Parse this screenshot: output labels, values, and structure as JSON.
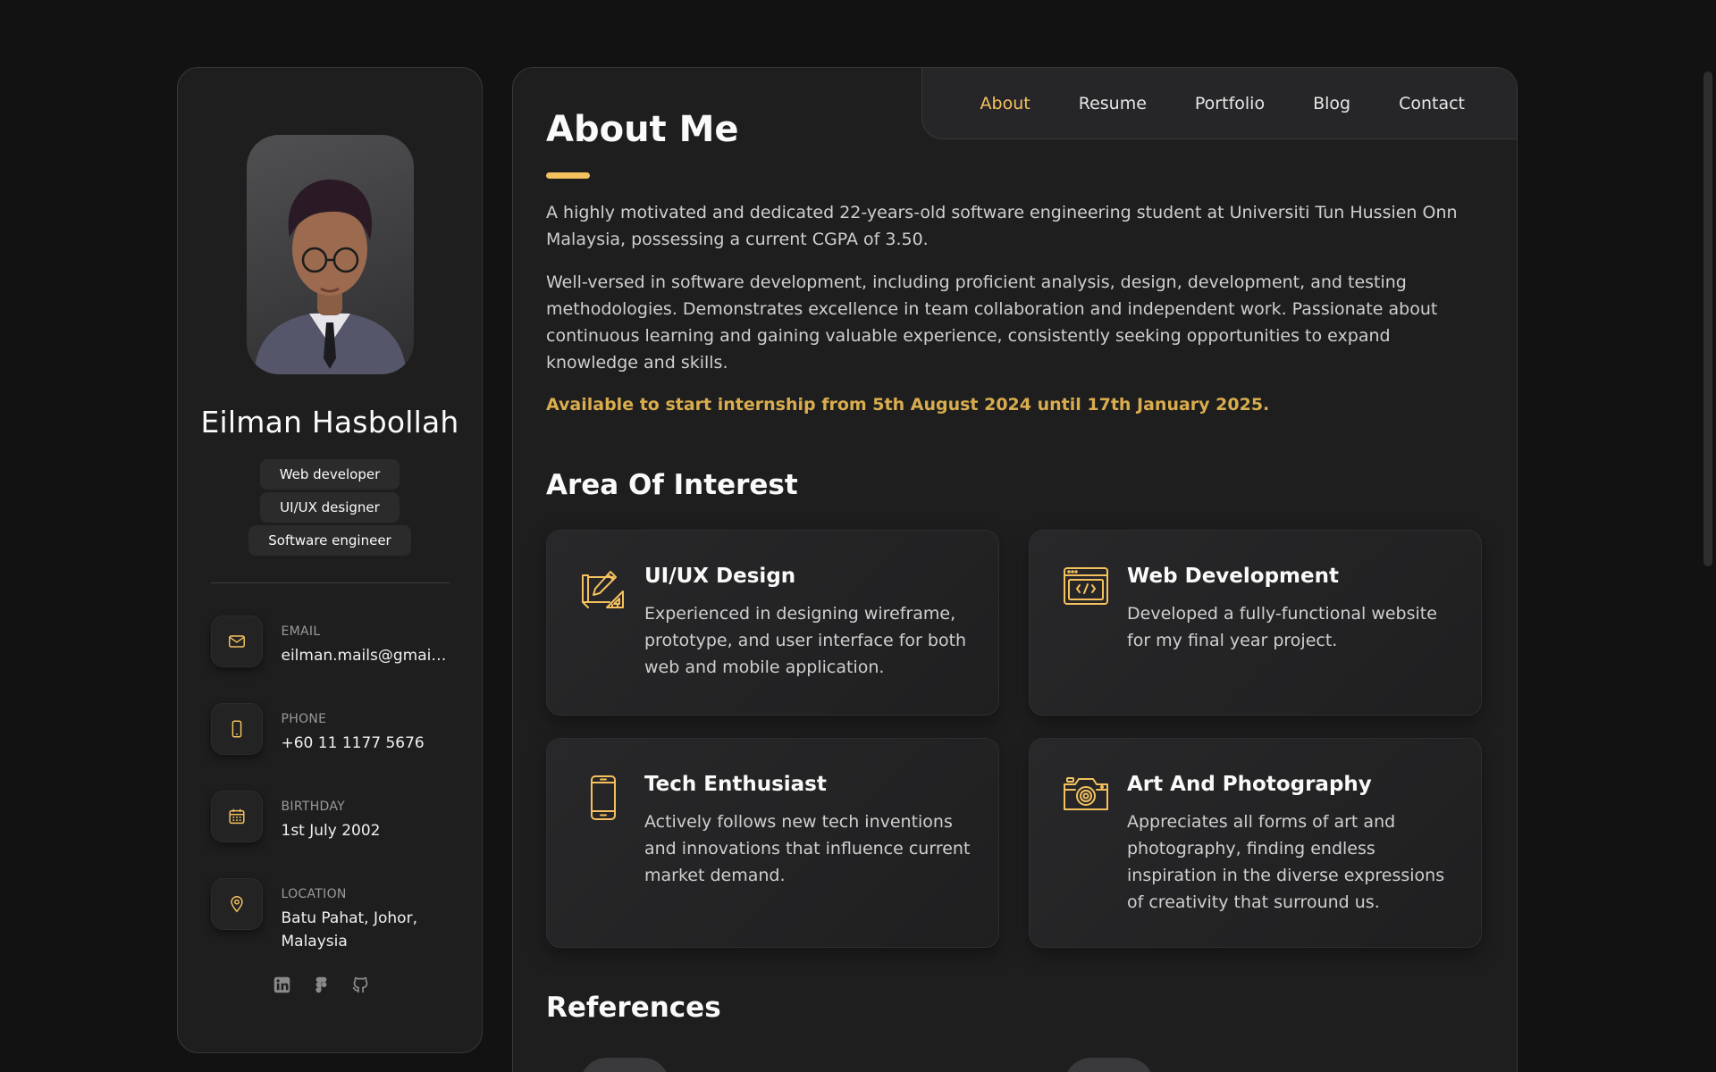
{
  "profile": {
    "name": "Eilman Hasbollah",
    "titles": [
      "Web developer",
      "UI/UX designer",
      "Software engineer"
    ]
  },
  "contacts": [
    {
      "icon": "mail-icon",
      "label": "Email",
      "value": "eilman.mails@gmail.com"
    },
    {
      "icon": "phone-icon",
      "label": "Phone",
      "value": "+60 11 1177 5676"
    },
    {
      "icon": "calendar-icon",
      "label": "Birthday",
      "value": "1st July 2002"
    },
    {
      "icon": "location-pin-icon",
      "label": "Location",
      "value": "Batu Pahat, Johor, Malaysia"
    }
  ],
  "socials": [
    "linkedin-icon",
    "figma-icon",
    "github-icon"
  ],
  "nav": {
    "items": [
      "About",
      "Resume",
      "Portfolio",
      "Blog",
      "Contact"
    ],
    "active": "About"
  },
  "about": {
    "title": "About Me",
    "paragraphs": [
      "A highly motivated and dedicated 22-years-old software engineering student at Universiti Tun Hussien Onn Malaysia, possessing a current CGPA of 3.50.",
      "Well-versed in software development, including proficient analysis, design, development, and testing methodologies. Demonstrates excellence in team collaboration and independent work. Passionate about continuous learning and gaining valuable experience, consistently seeking opportunities to expand knowledge and skills."
    ],
    "availability": "Available to start internship from 5th August 2024 until 17th January 2025."
  },
  "interests": {
    "title": "Area Of Interest",
    "items": [
      {
        "icon": "design-tools-icon",
        "title": "UI/UX Design",
        "desc": "Experienced in designing wireframe, prototype, and user interface for both web and mobile application."
      },
      {
        "icon": "code-window-icon",
        "title": "Web Development",
        "desc": "Developed a fully-functional website for my final year project."
      },
      {
        "icon": "smartphone-icon",
        "title": "Tech Enthusiast",
        "desc": "Actively follows new tech inventions and innovations that influence current market demand."
      },
      {
        "icon": "camera-icon",
        "title": "Art And Photography",
        "desc": "Appreciates all forms of art and photography, finding endless inspiration in the diverse expressions of creativity that surround us."
      }
    ]
  },
  "references": {
    "title": "References"
  },
  "colors": {
    "accent": "#f5c15e",
    "availability": "#d9ad4e",
    "background": "#121212",
    "card": "#1e1e1f"
  }
}
